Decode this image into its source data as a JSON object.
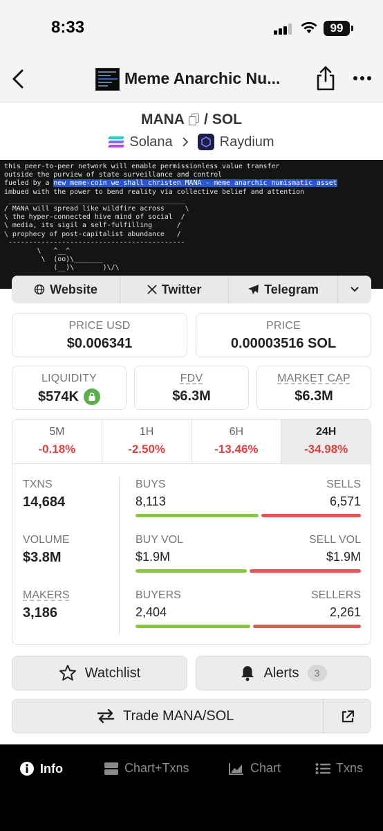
{
  "status_bar": {
    "time": "8:33",
    "battery": "99"
  },
  "nav": {
    "title": "Meme Anarchic Nu..."
  },
  "pair": {
    "base": "MANA",
    "separator": "/",
    "quote": "SOL",
    "chain": "Solana",
    "dex": "Raydium"
  },
  "terminal": {
    "lines_before": [
      "this peer-to-peer network will enable permissionless value transfer",
      "outside the purview of state surveillance and control"
    ],
    "line_fueled_prefix": "fueled by a ",
    "line_fueled_highlight": "new meme-coin we shall christen MANA - meme anarchic numismatic asset",
    "lines_after": [
      "imbued with the power to bend reality via collective belief and attention",
      "",
      " ___________________________________________",
      "/ MANA will spread like wildfire across     \\",
      "\\ the hyper-connected hive mind of social  /",
      "\\ media, its sigil a self-fulfilling      /",
      "\\ prophecy of post-capitalist abundance   /",
      " -------------------------------------------",
      "        \\   ^__^",
      "         \\  (oo)\\_______",
      "            (__)\\       )\\/\\"
    ]
  },
  "links": {
    "website": "Website",
    "twitter": "Twitter",
    "telegram": "Telegram"
  },
  "prices": {
    "price_usd_label": "PRICE USD",
    "price_usd": "$0.006341",
    "price_label": "PRICE",
    "price_sol": "0.00003516 SOL"
  },
  "stats": {
    "liquidity_label": "LIQUIDITY",
    "liquidity": "$574K",
    "fdv_label": "FDV",
    "fdv": "$6.3M",
    "mcap_label": "MARKET CAP",
    "mcap": "$6.3M"
  },
  "timeframes": [
    {
      "label": "5M",
      "change": "-0.18%"
    },
    {
      "label": "1H",
      "change": "-2.50%"
    },
    {
      "label": "6H",
      "change": "-13.46%"
    },
    {
      "label": "24H",
      "change": "-34.98%"
    }
  ],
  "metrics": {
    "txns_label": "TXNS",
    "txns": "14,684",
    "volume_label": "VOLUME",
    "volume": "$3.8M",
    "makers_label": "MAKERS",
    "makers": "3,186",
    "buys_label": "BUYS",
    "buys": "8,113",
    "sells_label": "SELLS",
    "sells": "6,571",
    "buy_vol_label": "BUY VOL",
    "buy_vol": "$1.9M",
    "sell_vol_label": "SELL VOL",
    "sell_vol": "$1.9M",
    "buyers_label": "BUYERS",
    "buyers": "2,404",
    "sellers_label": "SELLERS",
    "sellers": "2,261",
    "buys_fraction": 0.553,
    "buy_vol_fraction": 0.5,
    "buyers_fraction": 0.515
  },
  "actions": {
    "watchlist": "Watchlist",
    "alerts": "Alerts",
    "alerts_count": "3",
    "trade": "Trade MANA/SOL"
  },
  "tabs": {
    "info": "Info",
    "chart_txns": "Chart+Txns",
    "chart": "Chart",
    "txns": "Txns"
  },
  "colors": {
    "buy_green": "#8cc63e",
    "sell_red": "#e65454",
    "negative_change": "#e04040",
    "highlight_blue": "#2859c8"
  }
}
